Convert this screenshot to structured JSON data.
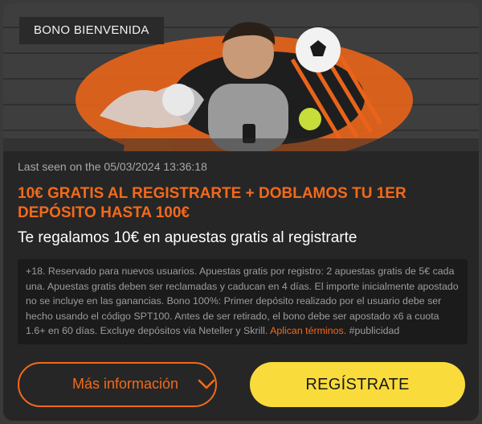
{
  "promo": {
    "badge": "BONO BIENVENIDA",
    "last_seen": "Last seen on the 05/03/2024 13:36:18",
    "title": "10€ GRATIS AL REGISTRARTE + DOBLAMOS TU 1ER DEPÓSITO HASTA 100€",
    "subtitle": "Te regalamos 10€ en apuestas gratis al registrarte",
    "terms_text": "+18. Reservado para nuevos usuarios. Apuestas gratis por registro: 2 apuestas gratis de 5€ cada una. Apuestas gratis deben ser reclamadas y caducan en 4 días. El importe inicialmente apostado no se incluye en las ganancias. Bono 100%: Primer depósito realizado por el usuario debe ser hecho usando el código SPT100. Antes de ser retirado, el bono debe ser apostado x6 a cuota 1.6+ en 60 días. Excluye depósitos via Neteller y Skrill. ",
    "terms_link": "Aplican términos.",
    "terms_tag": " #publicidad",
    "more_info_label": "Más información",
    "register_label": "REGÍSTRATE"
  },
  "icons": {
    "more_info_chevron": "chevron-down-icon"
  },
  "colors": {
    "accent_orange": "#f26a1b",
    "cta_yellow": "#f9dc3c",
    "card_bg": "#262626",
    "terms_bg": "#1b1b1b"
  }
}
